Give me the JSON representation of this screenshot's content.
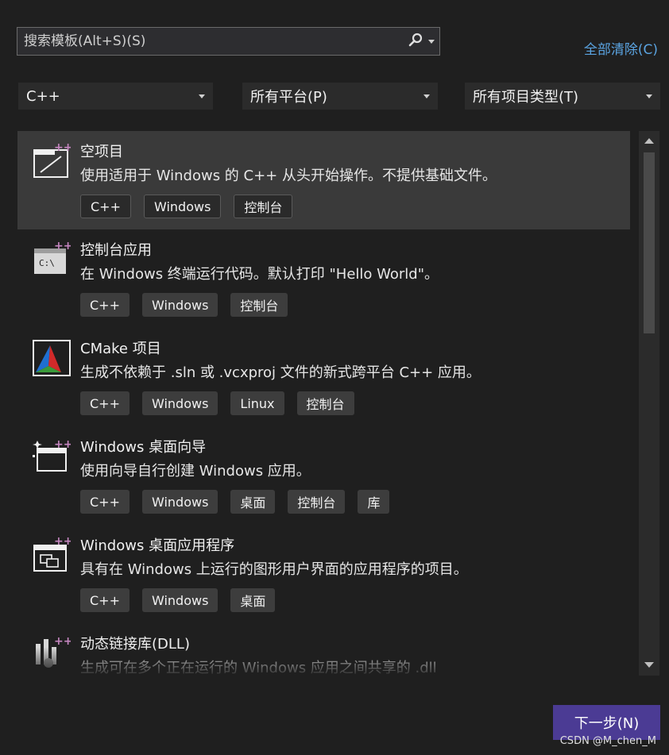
{
  "search": {
    "placeholder": "搜索模板(Alt+S)(S)"
  },
  "clear_all": "全部清除(C)",
  "filters": {
    "language": "C++",
    "platform": "所有平台(P)",
    "project_type": "所有项目类型(T)"
  },
  "templates": [
    {
      "title": "空项目",
      "description": "使用适用于 Windows 的 C++ 从头开始操作。不提供基础文件。",
      "tags": [
        "C++",
        "Windows",
        "控制台"
      ],
      "selected": true,
      "icon": "empty-project-icon"
    },
    {
      "title": "控制台应用",
      "description": "在 Windows 终端运行代码。默认打印 \"Hello World\"。",
      "tags": [
        "C++",
        "Windows",
        "控制台"
      ],
      "icon": "console-app-icon",
      "icon_text": "C:\\"
    },
    {
      "title": "CMake 项目",
      "description": "生成不依赖于 .sln 或 .vcxproj 文件的新式跨平台 C++ 应用。",
      "tags": [
        "C++",
        "Windows",
        "Linux",
        "控制台"
      ],
      "icon": "cmake-icon"
    },
    {
      "title": "Windows 桌面向导",
      "description": "使用向导自行创建 Windows 应用。",
      "tags": [
        "C++",
        "Windows",
        "桌面",
        "控制台",
        "库"
      ],
      "icon": "desktop-wizard-icon"
    },
    {
      "title": "Windows 桌面应用程序",
      "description": "具有在 Windows 上运行的图形用户界面的应用程序的项目。",
      "tags": [
        "C++",
        "Windows",
        "桌面"
      ],
      "icon": "desktop-app-icon"
    },
    {
      "title": "动态链接库(DLL)",
      "description": "生成可在多个正在运行的 Windows 应用之间共享的 .dll",
      "tags": [],
      "icon": "dll-icon"
    }
  ],
  "next_button": "下一步(N)",
  "watermark": "CSDN @M_chen_M",
  "colors": {
    "accent": "#4b3b94",
    "link": "#5aa3e0",
    "plus": "#c586c0"
  }
}
